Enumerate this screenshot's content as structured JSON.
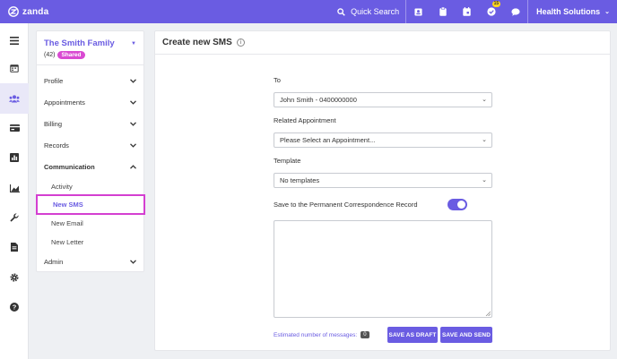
{
  "brand": {
    "name": "zanda",
    "accent": "#6a5ce2",
    "highlight": "#d43fd1"
  },
  "topbar": {
    "search_label": "Quick Search",
    "icons": [
      "contacts-icon",
      "clipboard-icon",
      "calendar-icon",
      "tasks-icon",
      "chat-icon"
    ],
    "tasks_badge": "15",
    "account_name": "Health Solutions"
  },
  "rail": {
    "items": [
      "menu-icon",
      "calendar-icon",
      "clients-icon",
      "billing-icon",
      "reports-icon",
      "analytics-icon",
      "tools-icon",
      "documents-icon",
      "settings-icon",
      "help-icon"
    ],
    "active": "clients-icon"
  },
  "client": {
    "name": "The Smith Family",
    "count": "(42)",
    "badge": "Shared"
  },
  "nav": {
    "profile": "Profile",
    "appointments": "Appointments",
    "billing": "Billing",
    "records": "Records",
    "communication": "Communication",
    "admin": "Admin",
    "communication_items": [
      "Activity",
      "New SMS",
      "New Email",
      "New Letter"
    ]
  },
  "form": {
    "title": "Create new SMS",
    "to_label": "To",
    "to_value": "John Smith - 0400000000",
    "appointment_label": "Related Appointment",
    "appointment_value": "Please Select an Appointment...",
    "template_label": "Template",
    "template_value": "No templates",
    "save_record_label": "Save to the Permanent Correspondence Record",
    "save_record_on": true,
    "message_value": "",
    "estimate_label": "Estimated number of messages:",
    "estimate_count": "0",
    "save_draft_label": "SAVE AS DRAFT",
    "save_send_label": "SAVE AND SEND"
  }
}
